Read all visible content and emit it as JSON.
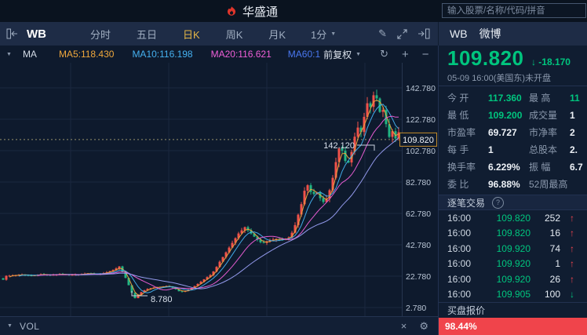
{
  "header": {
    "logo_text": "华盛通",
    "search_placeholder": "输入股票/名称/代码/拼音"
  },
  "toolbar": {
    "symbol": "WB",
    "tabs": [
      {
        "label": "分时",
        "active": false
      },
      {
        "label": "五日",
        "active": false
      },
      {
        "label": "日K",
        "active": true
      },
      {
        "label": "周K",
        "active": false
      },
      {
        "label": "月K",
        "active": false
      }
    ],
    "interval": "1分"
  },
  "ma_bar": {
    "group": "MA",
    "ma5": "MA5:118.430",
    "ma10": "MA10:116.198",
    "ma20": "MA20:116.621",
    "ma60": "MA60:1",
    "adjust": "前复权"
  },
  "chart_data": {
    "type": "candlestick",
    "title": "WB 微博 日K 前复权",
    "y_ticks": [
      "142.780",
      "122.780",
      "102.780",
      "82.780",
      "62.780",
      "42.780",
      "22.780",
      "2.780"
    ],
    "current_price": 109.82,
    "current_price_label": "109.820",
    "high_label": "142.120",
    "low_label": "8.780",
    "high_value": 142.12,
    "low_value": 8.78,
    "grid": true,
    "path": [
      [
        0,
        24
      ],
      [
        4,
        20.5
      ],
      [
        8,
        23
      ],
      [
        16,
        23.2
      ],
      [
        28,
        23.8
      ],
      [
        40,
        23
      ],
      [
        52,
        24
      ],
      [
        64,
        23.4
      ],
      [
        76,
        24.2
      ],
      [
        88,
        23.6
      ],
      [
        100,
        23.8
      ],
      [
        112,
        24.6
      ],
      [
        124,
        24
      ],
      [
        136,
        25.2
      ],
      [
        146,
        27
      ],
      [
        152,
        29
      ],
      [
        158,
        24
      ],
      [
        164,
        17
      ],
      [
        169,
        11
      ],
      [
        172,
        8.78
      ],
      [
        178,
        12
      ],
      [
        186,
        14.4
      ],
      [
        196,
        15.6
      ],
      [
        206,
        16
      ],
      [
        214,
        16.6
      ],
      [
        222,
        15
      ],
      [
        230,
        12.6
      ],
      [
        238,
        13.6
      ],
      [
        246,
        15.8
      ],
      [
        254,
        18.5
      ],
      [
        262,
        21.5
      ],
      [
        268,
        23.5
      ],
      [
        274,
        27
      ],
      [
        280,
        32
      ],
      [
        288,
        38
      ],
      [
        296,
        44
      ],
      [
        304,
        50
      ],
      [
        312,
        54
      ],
      [
        318,
        51
      ],
      [
        326,
        47
      ],
      [
        334,
        43.5
      ],
      [
        342,
        45.5
      ],
      [
        352,
        46.5
      ],
      [
        360,
        46
      ],
      [
        368,
        47.5
      ],
      [
        374,
        52
      ],
      [
        380,
        62
      ],
      [
        386,
        72
      ],
      [
        390,
        82.5
      ],
      [
        394,
        79
      ],
      [
        398,
        74
      ],
      [
        403,
        77
      ],
      [
        408,
        72.5
      ],
      [
        413,
        69.5
      ],
      [
        418,
        74
      ],
      [
        423,
        83
      ],
      [
        427,
        93
      ],
      [
        431,
        103
      ],
      [
        434,
        106.5
      ],
      [
        438,
        99
      ],
      [
        442,
        93.5
      ],
      [
        446,
        97
      ],
      [
        450,
        107
      ],
      [
        453,
        114
      ],
      [
        456,
        117.5
      ],
      [
        459,
        112.5
      ],
      [
        462,
        119
      ],
      [
        465,
        127
      ],
      [
        468,
        133
      ],
      [
        471,
        129
      ],
      [
        474,
        134
      ],
      [
        478,
        142.12
      ],
      [
        481,
        133
      ],
      [
        484,
        127.5
      ],
      [
        487,
        131
      ],
      [
        490,
        124
      ],
      [
        493,
        117.5
      ],
      [
        496,
        111.5
      ],
      [
        499,
        116.5
      ],
      [
        502,
        112.5
      ],
      [
        505,
        109.5
      ],
      [
        508,
        114.5
      ],
      [
        512,
        109.82
      ]
    ],
    "ma_values": {
      "ma5": 118.43,
      "ma10": 116.198,
      "ma20": 116.621
    },
    "colors": {
      "up": "#f0524a",
      "down": "#22b584",
      "ma5": "#f0a83c",
      "ma10": "#45b1f0",
      "ma20": "#ef5fd8",
      "ma60": "#9aa0f5"
    }
  },
  "vol_bar": {
    "label": "VOL"
  },
  "quote": {
    "symbol": "WB",
    "name": "微博",
    "price": "109.820",
    "change": "-18.170",
    "direction": "down",
    "status_line": "05-09 16:00(美国东)未开盘",
    "stats": [
      {
        "label": "今 开",
        "value": "117.360",
        "color": "green"
      },
      {
        "label": "最 高",
        "value": "11",
        "color": "green"
      },
      {
        "label": "最 低",
        "value": "109.200",
        "color": "green"
      },
      {
        "label": "成交量",
        "value": "1",
        "color": "normal"
      },
      {
        "label": "市盈率",
        "value": "69.727",
        "color": "normal"
      },
      {
        "label": "市净率",
        "value": "2",
        "color": "normal"
      },
      {
        "label": "每 手",
        "value": "1",
        "color": "normal"
      },
      {
        "label": "总股本",
        "value": "2.",
        "color": "normal"
      },
      {
        "label": "换手率",
        "value": "6.229%",
        "color": "normal"
      },
      {
        "label": "振 幅",
        "value": "6.7",
        "color": "normal"
      },
      {
        "label": "委 比",
        "value": "96.88%",
        "color": "normal"
      },
      {
        "label": "52周最高",
        "value": "",
        "color": "normal"
      }
    ]
  },
  "trades": {
    "title": "逐笔交易",
    "rows": [
      {
        "time": "16:00",
        "price": "109.820",
        "vol": "252",
        "dir": "up"
      },
      {
        "time": "16:00",
        "price": "109.820",
        "vol": "16",
        "dir": "up"
      },
      {
        "time": "16:00",
        "price": "109.920",
        "vol": "74",
        "dir": "up"
      },
      {
        "time": "16:00",
        "price": "109.920",
        "vol": "1",
        "dir": "up"
      },
      {
        "time": "16:00",
        "price": "109.920",
        "vol": "26",
        "dir": "up"
      },
      {
        "time": "16:00",
        "price": "109.905",
        "vol": "100",
        "dir": "down"
      }
    ]
  },
  "bid": {
    "title": "买盘报价",
    "pct": "98.44%"
  },
  "theme": {
    "green": "#00c57e",
    "red": "#f0454d",
    "active_tab_yellow": "#e5b647",
    "bid_bar_red": "#f0444b",
    "price_box_border": "#c08a2a"
  }
}
